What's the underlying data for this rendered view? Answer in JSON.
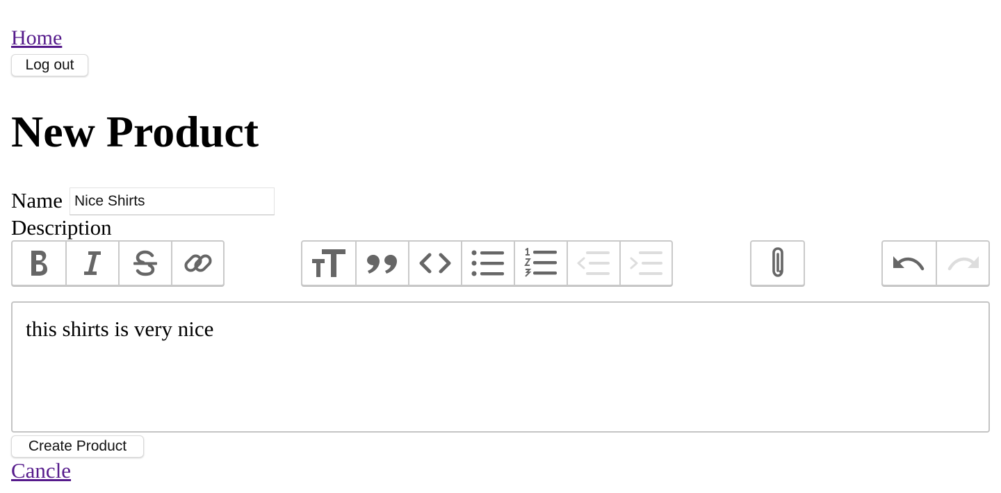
{
  "nav": {
    "home_link": "Home",
    "logout_label": "Log out"
  },
  "page": {
    "title": "New Product"
  },
  "form": {
    "name_label": "Name",
    "name_value": "Nice Shirts",
    "description_label": "Description",
    "description_value": "this shirts is very nice",
    "submit_label": "Create Product",
    "cancel_link": "Cancle"
  },
  "toolbar": {
    "groups": [
      {
        "name": "text-tools",
        "buttons": [
          {
            "icon": "bold-icon",
            "enabled": true
          },
          {
            "icon": "italic-icon",
            "enabled": true
          },
          {
            "icon": "strikethrough-icon",
            "enabled": true
          },
          {
            "icon": "link-icon",
            "enabled": true
          }
        ]
      },
      {
        "name": "block-tools",
        "buttons": [
          {
            "icon": "heading-icon",
            "enabled": true
          },
          {
            "icon": "quote-icon",
            "enabled": true
          },
          {
            "icon": "code-icon",
            "enabled": true
          },
          {
            "icon": "bullet-list-icon",
            "enabled": true
          },
          {
            "icon": "numbered-list-icon",
            "enabled": true
          },
          {
            "icon": "decrease-indent-icon",
            "enabled": false
          },
          {
            "icon": "increase-indent-icon",
            "enabled": false
          }
        ]
      },
      {
        "name": "file-tools",
        "buttons": [
          {
            "icon": "attach-files-icon",
            "enabled": true
          }
        ]
      },
      {
        "name": "history-tools",
        "buttons": [
          {
            "icon": "undo-icon",
            "enabled": true
          },
          {
            "icon": "redo-icon",
            "enabled": false
          }
        ]
      }
    ],
    "colors": {
      "icon_enabled": "#666666",
      "icon_disabled": "#dddddd",
      "border": "#c9c9c9"
    }
  }
}
